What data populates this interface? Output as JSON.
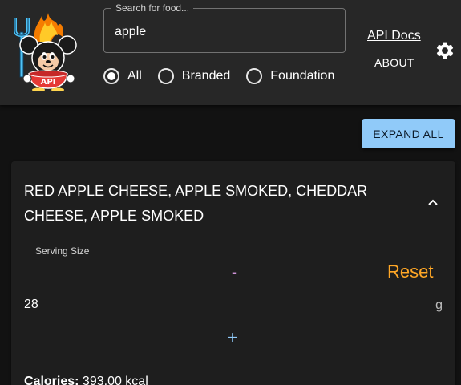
{
  "header": {
    "logo": {
      "badge_text": "API"
    },
    "search": {
      "label": "Search for food...",
      "value": "apple"
    },
    "filters": [
      {
        "label": "All",
        "selected": true
      },
      {
        "label": "Branded",
        "selected": false
      },
      {
        "label": "Foundation",
        "selected": false
      }
    ],
    "api_docs_label": "API Docs",
    "about_label": "ABOUT",
    "settings_icon": "gear-icon"
  },
  "main": {
    "expand_all_label": "EXPAND ALL",
    "food": {
      "title": "RED APPLE CHEESE, APPLE SMOKED, CHEDDAR CHEESE, APPLE SMOKED",
      "expanded": true,
      "serving": {
        "label": "Serving Size",
        "value": "28",
        "unit": "g",
        "decrement_label": "-",
        "increment_label": "+",
        "reset_label": "Reset"
      },
      "calories": {
        "label": "Calories:",
        "value": "393.00 kcal"
      }
    }
  },
  "colors": {
    "header_bg": "#272727",
    "page_bg": "#121212",
    "card_bg": "#1e1e1e",
    "primary": "#90caf9",
    "secondary": "#ce93d8",
    "warning": "#ffa726"
  }
}
